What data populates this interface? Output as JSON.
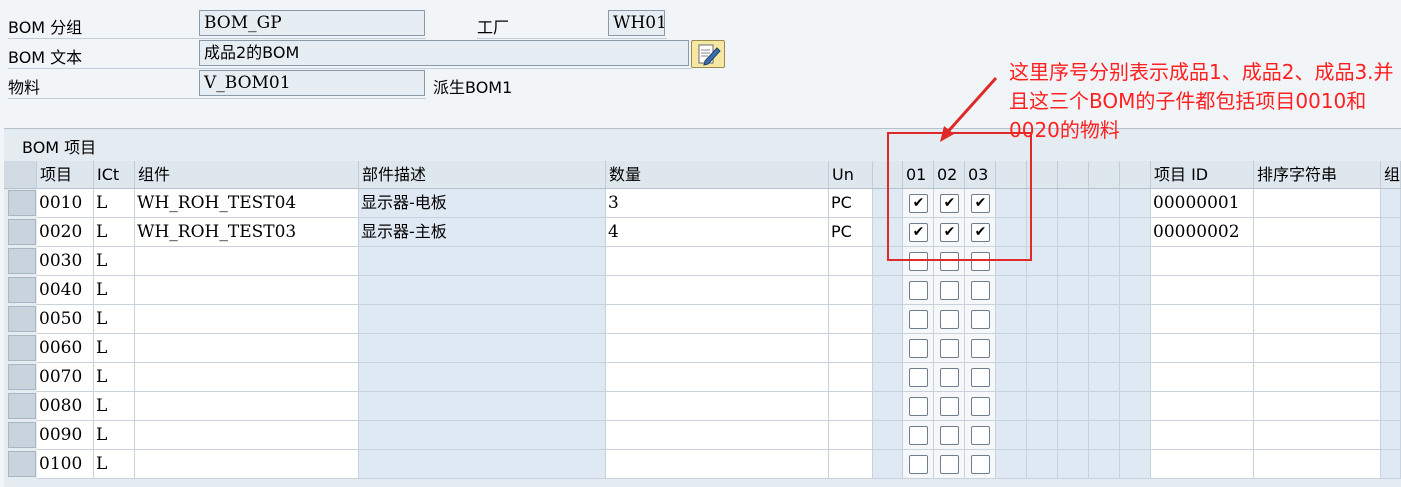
{
  "header": {
    "bom_group_label": "BOM 分组",
    "bom_group_value": "BOM_GP",
    "plant_label": "工厂",
    "plant_value": "WH01",
    "bom_text_label": "BOM 文本",
    "bom_text_value": "成品2的BOM",
    "material_label": "物料",
    "material_value": "V_BOM01",
    "derived_text": "派生BOM1"
  },
  "table": {
    "title": "BOM 项目",
    "columns": {
      "item": "项目",
      "ict": "ICt",
      "component": "组件",
      "desc": "部件描述",
      "qty": "数量",
      "un": "Un",
      "v01": "01",
      "v02": "02",
      "v03": "03",
      "item_id": "项目 ID",
      "sort": "排序字符串",
      "more": "组"
    },
    "rows": [
      {
        "item": "0010",
        "ict": "L",
        "component": "WH_ROH_TEST04",
        "desc": "显示器-电板",
        "qty": "3",
        "un": "PC",
        "c1": "✔",
        "c2": "✔",
        "c3": "✔",
        "item_id": "00000001"
      },
      {
        "item": "0020",
        "ict": "L",
        "component": "WH_ROH_TEST03",
        "desc": "显示器-主板",
        "qty": "4",
        "un": "PC",
        "c1": "✔",
        "c2": "✔",
        "c3": "✔",
        "item_id": "00000002"
      },
      {
        "item": "0030",
        "ict": "L",
        "component": "",
        "desc": "",
        "qty": "",
        "un": "",
        "c1": "",
        "c2": "",
        "c3": "",
        "item_id": ""
      },
      {
        "item": "0040",
        "ict": "L",
        "component": "",
        "desc": "",
        "qty": "",
        "un": "",
        "c1": "",
        "c2": "",
        "c3": "",
        "item_id": ""
      },
      {
        "item": "0050",
        "ict": "L",
        "component": "",
        "desc": "",
        "qty": "",
        "un": "",
        "c1": "",
        "c2": "",
        "c3": "",
        "item_id": ""
      },
      {
        "item": "0060",
        "ict": "L",
        "component": "",
        "desc": "",
        "qty": "",
        "un": "",
        "c1": "",
        "c2": "",
        "c3": "",
        "item_id": ""
      },
      {
        "item": "0070",
        "ict": "L",
        "component": "",
        "desc": "",
        "qty": "",
        "un": "",
        "c1": "",
        "c2": "",
        "c3": "",
        "item_id": ""
      },
      {
        "item": "0080",
        "ict": "L",
        "component": "",
        "desc": "",
        "qty": "",
        "un": "",
        "c1": "",
        "c2": "",
        "c3": "",
        "item_id": ""
      },
      {
        "item": "0090",
        "ict": "L",
        "component": "",
        "desc": "",
        "qty": "",
        "un": "",
        "c1": "",
        "c2": "",
        "c3": "",
        "item_id": ""
      },
      {
        "item": "0100",
        "ict": "L",
        "component": "",
        "desc": "",
        "qty": "",
        "un": "",
        "c1": "",
        "c2": "",
        "c3": "",
        "item_id": ""
      }
    ]
  },
  "annotation": {
    "text": "这里序号分别表示成品1、成品2、成品3.并且这三个BOM的子件都包括项目0010和0020的物料",
    "color": "#ff2020"
  }
}
